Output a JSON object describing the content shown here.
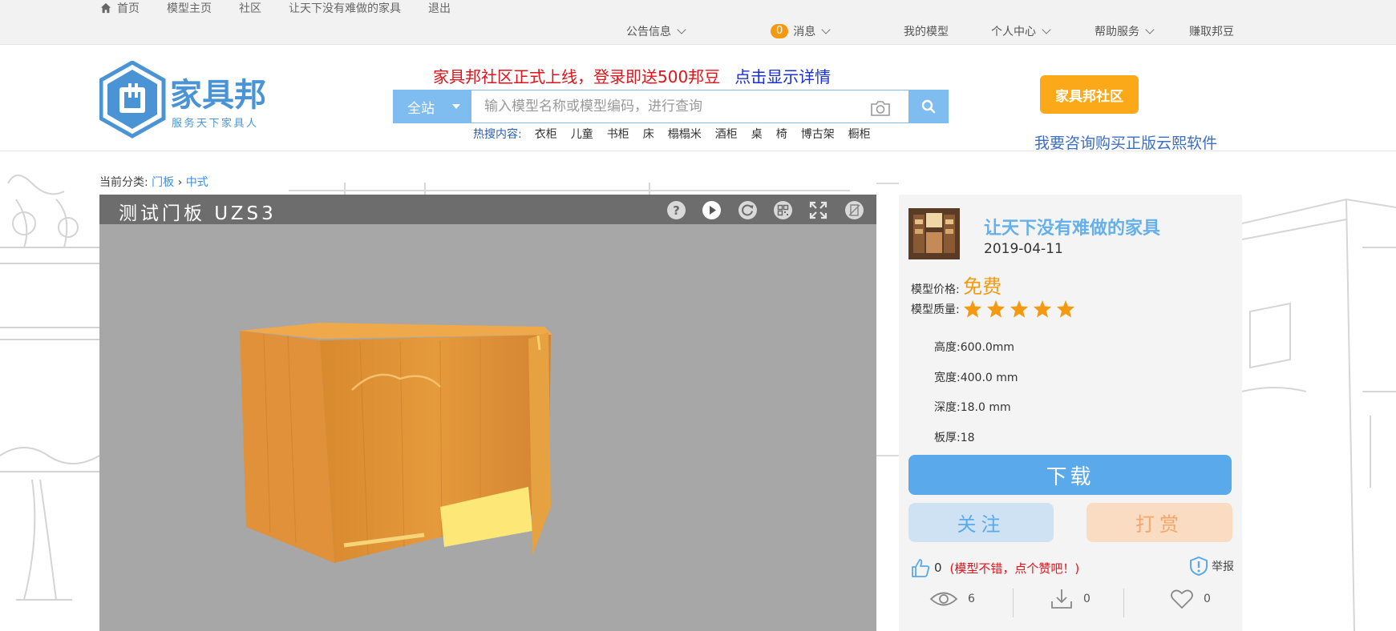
{
  "topbar": {
    "links": [
      "首页",
      "模型主页",
      "社区",
      "让天下没有难做的家具",
      "退出"
    ],
    "notice": "公告信息",
    "msg_count": "0",
    "msg": "消息",
    "my_models": "我的模型",
    "personal": "个人中心",
    "help": "帮助服务",
    "earn": "赚取邦豆"
  },
  "header": {
    "logo_text": "家具邦",
    "logo_slogan": "服务天下家具人",
    "promo": "家具邦社区正式上线，登录即送500邦豆",
    "promo_link": "点击显示详情",
    "search_scope": "全站",
    "search_placeholder": "输入模型名称或模型编码，进行查询",
    "hot_label": "热搜内容:",
    "hot_keywords": [
      "衣柜",
      "儿童",
      "书柜",
      "床",
      "榻榻米",
      "酒柜",
      "桌",
      "椅",
      "博古架",
      "橱柜"
    ],
    "community_btn": "家具邦社区",
    "consult_link": "我要咨询购买正版云熙软件"
  },
  "breadcrumb": {
    "label": "当前分类:",
    "items": [
      "门板",
      "中式"
    ]
  },
  "viewer": {
    "title": "测试门板 UZS3"
  },
  "panel": {
    "author": "让天下没有难做的家具",
    "date": "2019-04-11",
    "price_label": "模型价格:",
    "price": "免费",
    "quality_label": "模型质量:",
    "quality_stars": 5,
    "specs": [
      {
        "label": "高度:",
        "value": "600.0mm"
      },
      {
        "label": "宽度:",
        "value": "400.0 mm"
      },
      {
        "label": "深度:",
        "value": "18.0 mm"
      },
      {
        "label": "板厚:",
        "value": "18"
      }
    ],
    "download": "下载",
    "follow": "关注",
    "tip": "打赏",
    "likes": "0",
    "like_tip": "(模型不错，点个赞吧！)",
    "report": "举报",
    "views": "6",
    "downloads": "0",
    "favorites": "0"
  },
  "colors": {
    "accent_blue": "#5aa9eb",
    "orange": "#f39a12",
    "red": "#e0131b"
  }
}
